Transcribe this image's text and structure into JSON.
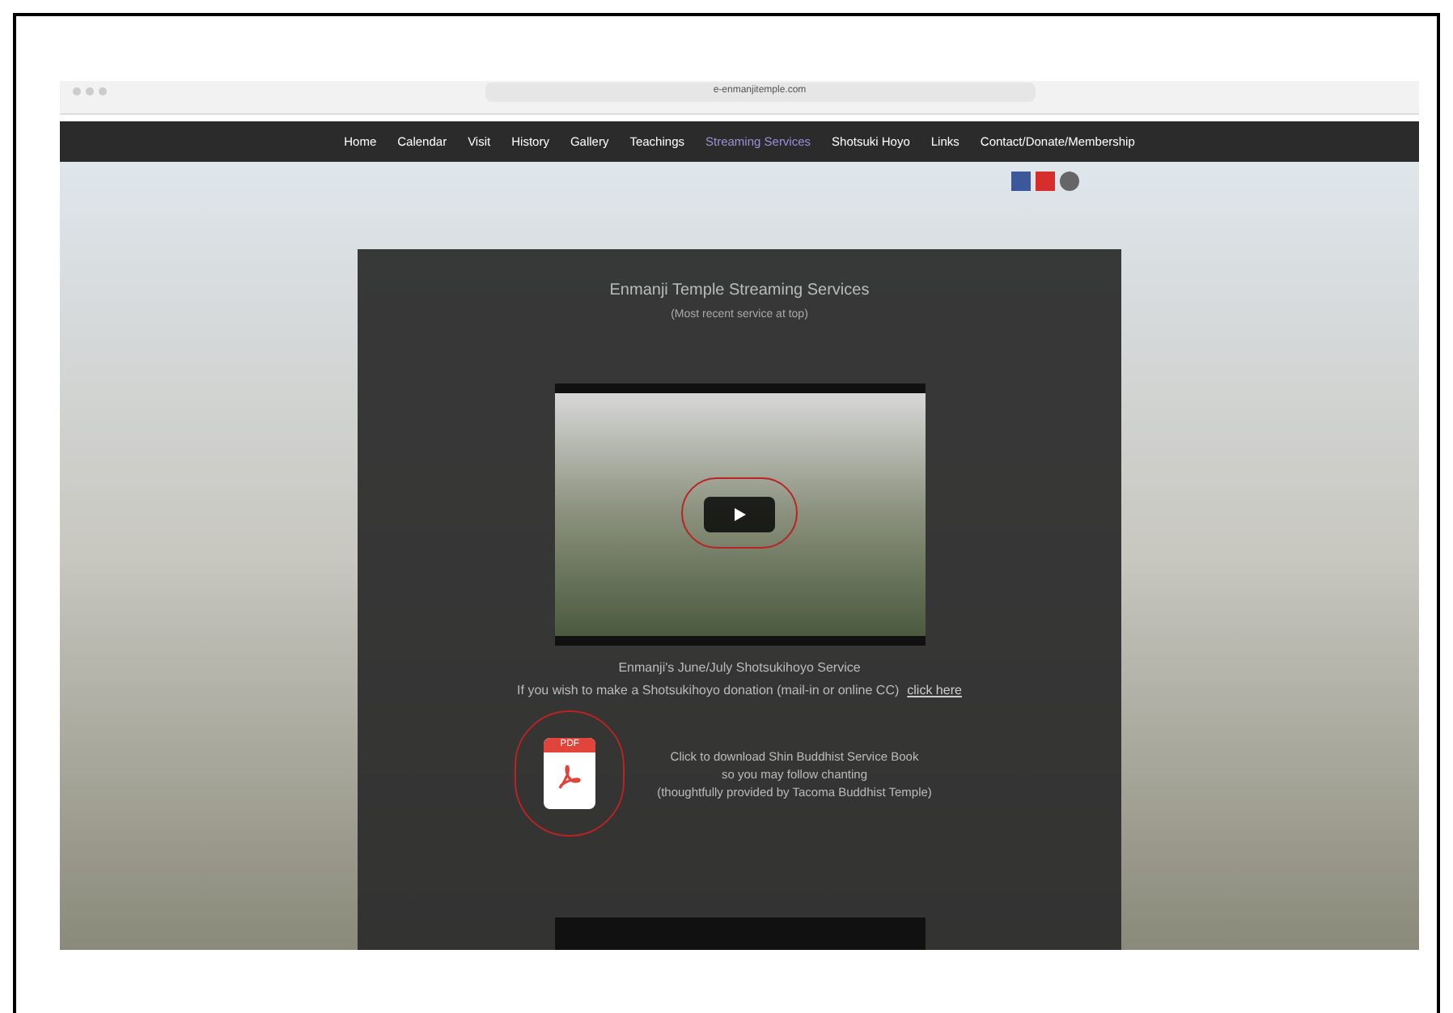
{
  "browser": {
    "url": "e-enmanjitemple.com"
  },
  "nav": [
    {
      "label": "Home",
      "selected": false
    },
    {
      "label": "Calendar",
      "selected": false
    },
    {
      "label": "Visit",
      "selected": false
    },
    {
      "label": "History",
      "selected": false
    },
    {
      "label": "Gallery",
      "selected": false
    },
    {
      "label": "Teachings",
      "selected": false
    },
    {
      "label": "Streaming Services",
      "selected": true
    },
    {
      "label": "Shotsuki Hoyo",
      "selected": false
    },
    {
      "label": "Links",
      "selected": false
    },
    {
      "label": "Contact/Donate/Membership",
      "selected": false
    }
  ],
  "panel": {
    "title": "Enmanji Temple Streaming Services",
    "subtitle": "(Most recent service at top)",
    "video_caption": "Enmanji's June/July Shotsukihoyo Service",
    "donation_text": "If you wish to make a Shotsukihoyo donation (mail-in or online CC)",
    "donation_link": "click here",
    "pdf_label": "PDF",
    "download_lines": [
      "Click to download Shin Buddhist Service Book",
      "so you may follow chanting",
      "(thoughtfully provided by Tacoma Buddhist Temple)"
    ]
  }
}
